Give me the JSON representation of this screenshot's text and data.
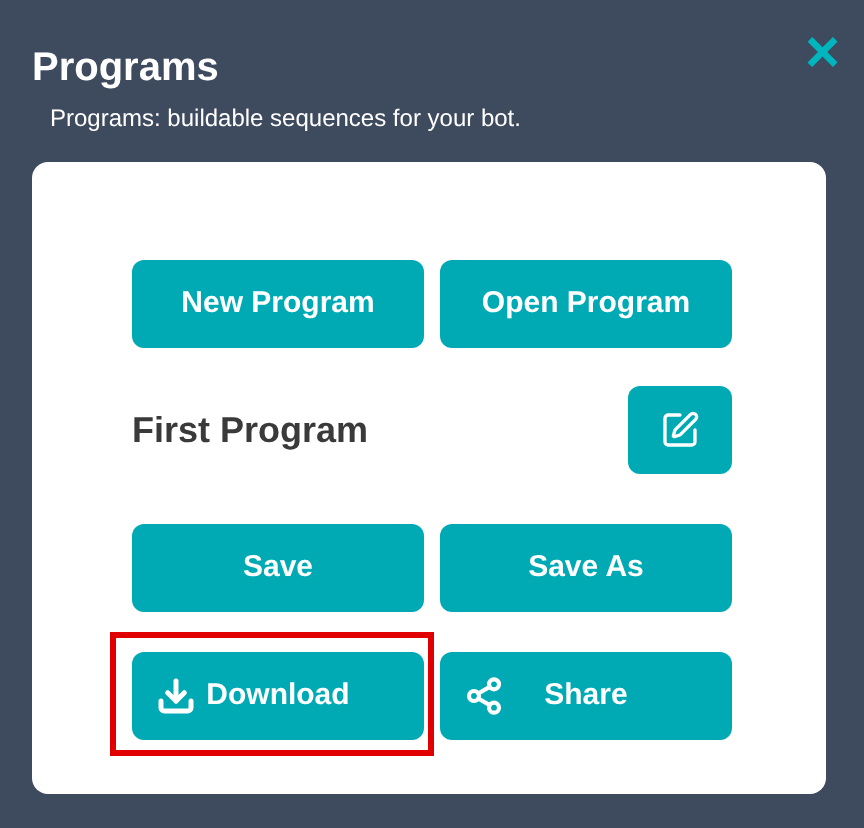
{
  "dialog": {
    "title": "Programs",
    "subtitle": "Programs: buildable sequences for your bot.",
    "close": "×"
  },
  "top_buttons": [
    {
      "label": "New Program"
    },
    {
      "label": "Open Program"
    }
  ],
  "program_name": "First Program",
  "action_buttons": [
    {
      "label": "Save",
      "kind": "plain",
      "highlighted": false
    },
    {
      "label": "Save As",
      "kind": "plain",
      "highlighted": false
    },
    {
      "label": "Download",
      "kind": "download",
      "highlighted": true
    },
    {
      "label": "Share",
      "kind": "share",
      "highlighted": false
    }
  ]
}
